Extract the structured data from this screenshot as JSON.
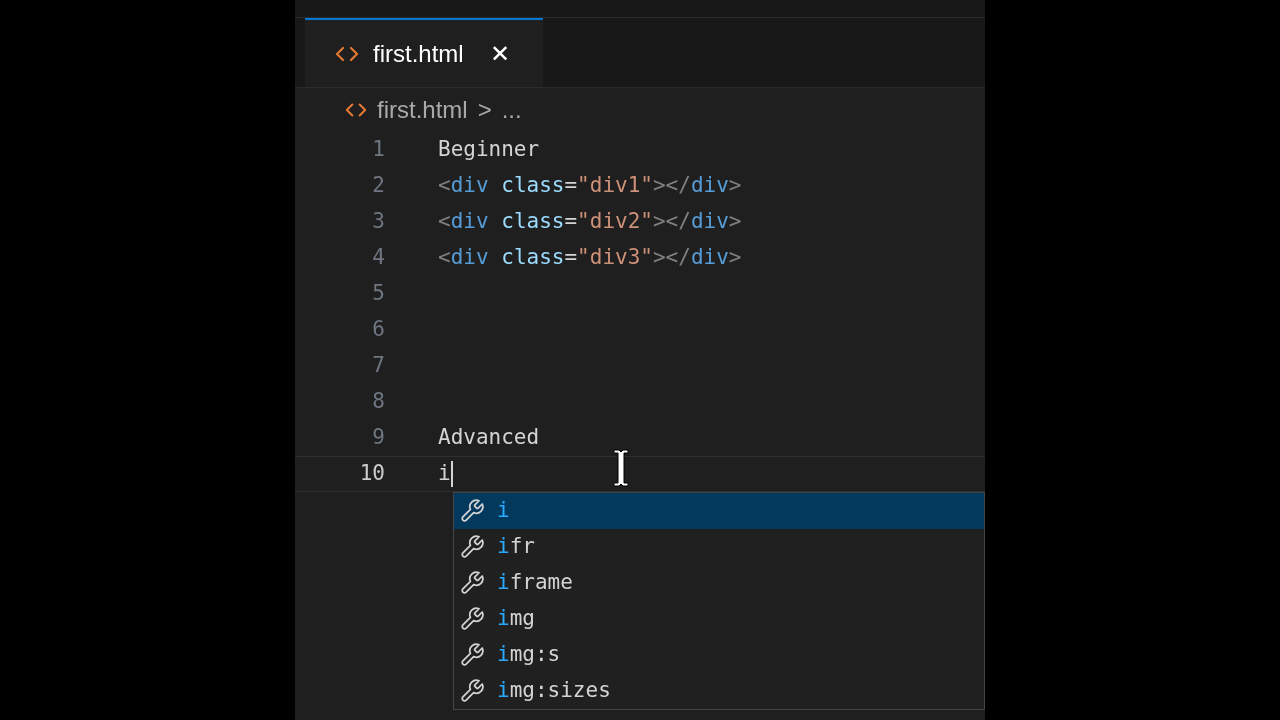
{
  "tab": {
    "label": "first.html",
    "selected": true,
    "close": "✕"
  },
  "breadcrumb": {
    "file": "first.html",
    "separator": ">",
    "rest": "..."
  },
  "lines": [
    {
      "number": "1",
      "current": false,
      "tokens": [
        {
          "text": "Beginner",
          "kind": "plain"
        }
      ]
    },
    {
      "number": "2",
      "current": false,
      "tokens": [
        {
          "text": "<",
          "kind": "punct"
        },
        {
          "text": "div",
          "kind": "tag"
        },
        {
          "text": "class",
          "kind": "attr"
        },
        {
          "text": "=",
          "kind": "plain"
        },
        {
          "text": "\"div1\"",
          "kind": "string"
        },
        {
          "text": "></",
          "kind": "punct"
        },
        {
          "text": "div",
          "kind": "tag"
        },
        {
          "text": ">",
          "kind": "punct"
        }
      ]
    },
    {
      "number": "3",
      "current": false,
      "tokens": [
        {
          "text": "<",
          "kind": "punct"
        },
        {
          "text": "div",
          "kind": "tag"
        },
        {
          "text": "class",
          "kind": "attr"
        },
        {
          "text": "=",
          "kind": "plain"
        },
        {
          "text": "\"div2\"",
          "kind": "string"
        },
        {
          "text": "></",
          "kind": "punct"
        },
        {
          "text": "div",
          "kind": "tag"
        },
        {
          "text": ">",
          "kind": "punct"
        }
      ]
    },
    {
      "number": "4",
      "current": false,
      "tokens": [
        {
          "text": "<",
          "kind": "punct"
        },
        {
          "text": "div",
          "kind": "tag"
        },
        {
          "text": "class",
          "kind": "attr"
        },
        {
          "text": "=",
          "kind": "plain"
        },
        {
          "text": "\"div3\"",
          "kind": "string"
        },
        {
          "text": "></",
          "kind": "punct"
        },
        {
          "text": "div",
          "kind": "tag"
        },
        {
          "text": ">",
          "kind": "punct"
        }
      ]
    },
    {
      "number": "5",
      "current": false
    },
    {
      "number": "6",
      "current": false
    },
    {
      "number": "7",
      "current": false
    },
    {
      "number": "8",
      "current": false
    },
    {
      "number": "9",
      "current": false,
      "tokens": [
        {
          "text": "Advanced",
          "kind": "plain"
        }
      ]
    },
    {
      "number": "10",
      "current": true,
      "tokens": [
        {
          "text": "i",
          "kind": "plain"
        }
      ]
    }
  ],
  "suggestions": [
    {
      "match": "i",
      "selected": true
    },
    {
      "match": "i",
      "rest": "fr",
      "selected": false
    },
    {
      "match": "i",
      "rest": "frame",
      "selected": false
    },
    {
      "match": "i",
      "rest": "mg",
      "selected": false
    },
    {
      "match": "i",
      "rest": "mg:s",
      "selected": false
    },
    {
      "match": "i",
      "rest": "mg:sizes",
      "selected": false
    }
  ]
}
